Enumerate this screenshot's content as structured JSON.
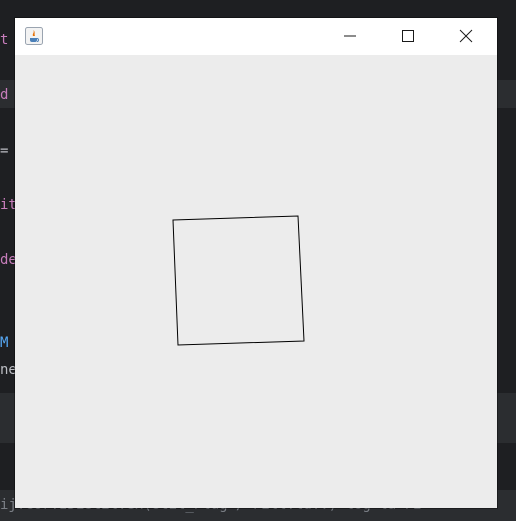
{
  "ide_background": {
    "lines": [
      {
        "text": "t",
        "color": "#c77dbb"
      },
      {
        "text": "d",
        "color": "#c77dbb"
      },
      {
        "text": "=",
        "color": "#bcbec4"
      },
      {
        "text": "it",
        "color": "#c77dbb"
      },
      {
        "text": "de",
        "color": "#c77dbb"
      },
      {
        "text": "M",
        "color": "#56a8f5"
      },
      {
        "text": "ne",
        "color": "#bcbec4"
      }
    ],
    "status_text": "ij.cor.IDEUtil.ex(Util_Plug / Fill.lu..) log la Fi"
  },
  "window": {
    "title": "",
    "icon": "java-cup-icon",
    "controls": [
      "minimize-icon",
      "maximize-icon",
      "close-icon"
    ],
    "background": "#ececec"
  },
  "canvas": {
    "shape": "rotated-square",
    "stroke": "#000000"
  }
}
